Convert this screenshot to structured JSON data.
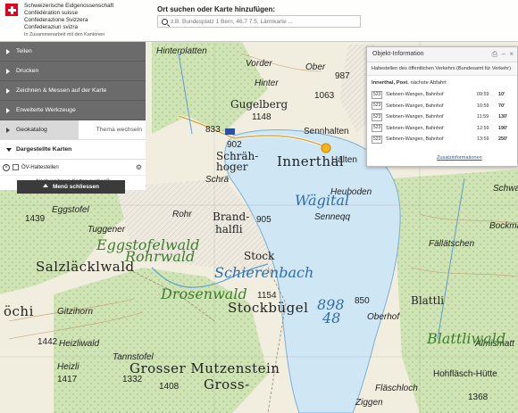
{
  "header": {
    "gov_lines": [
      "Schweizerische Eidgenossenschaft",
      "Confédération suisse",
      "Confederazione Svizzera",
      "Confederaziun svizra"
    ],
    "gov_sub": "In Zusammenarbeit mit den Kantonen",
    "search_title": "Ort suchen oder Karte hinzufügen:",
    "search_placeholder": "z.B. Bundesplatz 1 Bern, 46.7 7.5, Lärmkarte ..."
  },
  "menu": {
    "items": [
      "Teilen",
      "Drucken",
      "Zeichnen & Messen auf der Karte",
      "Erweiterte Werkzeuge"
    ],
    "tab_active": "Geokatalog",
    "tab_other": "Thema wechseln",
    "section_open": "Dargestellte Karten",
    "layer_label": "ÖV-Haltestellen",
    "layer_remove_symbol": "×",
    "layer_gear_symbol": "⚙",
    "more_maps": "Nach weiteren Karten suchen?",
    "close_label": "Menü schliessen"
  },
  "popup": {
    "title": "Objekt-Information",
    "print_symbol": "⎙",
    "minimize_symbol": "–",
    "close_symbol": "×",
    "layer_name": "Haltestellen des öffentlichen Verkehrs (Bundesamt für Verkehr)",
    "stop_name": "Innerthal, Post",
    "stop_suffix": ", nächste Abfahrt",
    "departures": [
      {
        "line": "523",
        "dest": "Siebnen-Wangen, Bahnhof",
        "time": "09:59",
        "min": "10'"
      },
      {
        "line": "523",
        "dest": "Siebnen-Wangen, Bahnhof",
        "time": "10:59",
        "min": "70'"
      },
      {
        "line": "523",
        "dest": "Siebnen-Wangen, Bahnhof",
        "time": "11:59",
        "min": "130'"
      },
      {
        "line": "523",
        "dest": "Siebnen-Wangen, Bahnhof",
        "time": "12:59",
        "min": "190'"
      },
      {
        "line": "523",
        "dest": "Siebnen-Wangen, Bahnhof",
        "time": "13:59",
        "min": "250'"
      }
    ],
    "link": "Zusatzinformationen"
  },
  "map_labels": [
    {
      "text": "Vorder",
      "kind": "italic sm"
    },
    {
      "text": "Hinter",
      "kind": "italic sm"
    },
    {
      "text": "Ober",
      "kind": "italic sm"
    },
    {
      "text": "Gugelberg",
      "kind": "mid"
    },
    {
      "text": "1148",
      "kind": "num"
    },
    {
      "text": "1063",
      "kind": "num"
    },
    {
      "text": "987",
      "kind": "num"
    },
    {
      "text": "Sennhalten",
      "kind": "sm"
    },
    {
      "text": "902",
      "kind": "num"
    },
    {
      "text": "833",
      "kind": "num"
    },
    {
      "text": "Schräh-",
      "kind": "mid"
    },
    {
      "text": "hoger",
      "kind": "mid"
    },
    {
      "text": "Innerthal",
      "kind": "big"
    },
    {
      "text": "Halten",
      "kind": "sm"
    },
    {
      "text": "Heuboden",
      "kind": "italic sm"
    },
    {
      "text": "Senneqq",
      "kind": "italic sm"
    },
    {
      "text": "1439",
      "kind": "num"
    },
    {
      "text": "Eggstofel",
      "kind": "italic sm"
    },
    {
      "text": "Tuggener",
      "kind": "italic sm"
    },
    {
      "text": "Eggstofelwald",
      "kind": "green"
    },
    {
      "text": "Rohrwald",
      "kind": "green"
    },
    {
      "text": "Salzläcklwald",
      "kind": "big"
    },
    {
      "text": "Rohr",
      "kind": "italic sm"
    },
    {
      "text": "Brand-",
      "kind": "mid"
    },
    {
      "text": "halfli",
      "kind": "mid"
    },
    {
      "text": "905",
      "kind": "num"
    },
    {
      "text": "Stock",
      "kind": "mid"
    },
    {
      "text": "1154",
      "kind": "num"
    },
    {
      "text": "Stockbügel",
      "kind": "big"
    },
    {
      "text": "Schierenbach",
      "kind": "water"
    },
    {
      "text": "Drosenwald",
      "kind": "green"
    },
    {
      "text": "Gitzihorn",
      "kind": "italic sm"
    },
    {
      "text": "Heizliwald",
      "kind": "italic sm"
    },
    {
      "text": "1442",
      "kind": "num"
    },
    {
      "text": "Tannstofel",
      "kind": "italic sm"
    },
    {
      "text": "Grosser Mutzenstein",
      "kind": "big"
    },
    {
      "text": "Gross-",
      "kind": "big"
    },
    {
      "text": "Heizli",
      "kind": "italic sm"
    },
    {
      "text": "1417",
      "kind": "num"
    },
    {
      "text": "1332",
      "kind": "num"
    },
    {
      "text": "1408",
      "kind": "num"
    },
    {
      "text": "898",
      "kind": "water"
    },
    {
      "text": "48",
      "kind": "water"
    },
    {
      "text": "850",
      "kind": "num"
    },
    {
      "text": "Oberhof",
      "kind": "italic sm"
    },
    {
      "text": "Blattli",
      "kind": "mid"
    },
    {
      "text": "Fällätschen",
      "kind": "italic sm"
    },
    {
      "text": "Bockmat",
      "kind": "italic sm"
    },
    {
      "text": "Almismatt",
      "kind": "italic sm"
    },
    {
      "text": "Hohfläsch-Hütte",
      "kind": "sm"
    },
    {
      "text": "Fläschloch",
      "kind": "italic sm"
    },
    {
      "text": "Ziggen",
      "kind": "italic sm"
    },
    {
      "text": "1368",
      "kind": "num"
    },
    {
      "text": "Blattliwald",
      "kind": "green"
    },
    {
      "text": "Wägital",
      "kind": "water"
    },
    {
      "text": "Schwarze",
      "kind": "italic sm"
    },
    {
      "text": "Hinterplatten",
      "kind": "italic sm"
    },
    {
      "text": "öchi",
      "kind": "big"
    },
    {
      "text": "Schrä",
      "kind": "italic sm"
    }
  ]
}
